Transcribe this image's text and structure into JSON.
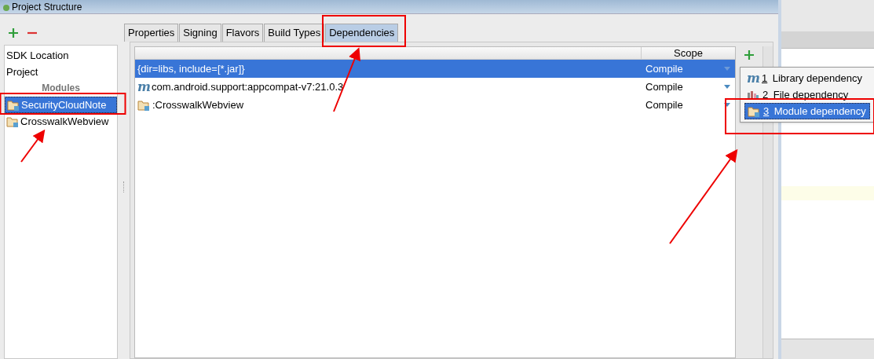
{
  "window": {
    "title": "Project Structure"
  },
  "sidebar": {
    "items": [
      {
        "kind": "item",
        "label": "SDK Location",
        "selected": false
      },
      {
        "kind": "item",
        "label": "Project",
        "selected": false
      },
      {
        "kind": "header",
        "label": "Modules"
      },
      {
        "kind": "module",
        "label": "SecurityCloudNote",
        "selected": true
      },
      {
        "kind": "module",
        "label": "CrosswalkWebview",
        "selected": false
      }
    ]
  },
  "tabs": [
    {
      "label": "Properties",
      "selected": false
    },
    {
      "label": "Signing",
      "selected": false
    },
    {
      "label": "Flavors",
      "selected": false
    },
    {
      "label": "Build Types",
      "selected": false
    },
    {
      "label": "Dependencies",
      "selected": true
    }
  ],
  "table": {
    "scope_column": "Scope",
    "rows": [
      {
        "kind": "jar",
        "name": "{dir=libs, include=[*.jar]}",
        "scope": "Compile",
        "selected": true
      },
      {
        "kind": "library",
        "icon_text": "m",
        "name": "com.android.support:appcompat-v7:21.0.3",
        "scope": "Compile",
        "selected": false
      },
      {
        "kind": "module",
        "name": ":CrosswalkWebview",
        "scope": "Compile",
        "selected": false
      }
    ]
  },
  "add_menu": {
    "items": [
      {
        "kind": "library",
        "icon_text": "m",
        "number": "1",
        "label": "Library dependency",
        "selected": false
      },
      {
        "kind": "file",
        "number": "2",
        "label": "File dependency",
        "selected": false
      },
      {
        "kind": "module",
        "number": "3",
        "label": "Module dependency",
        "selected": true
      }
    ]
  }
}
